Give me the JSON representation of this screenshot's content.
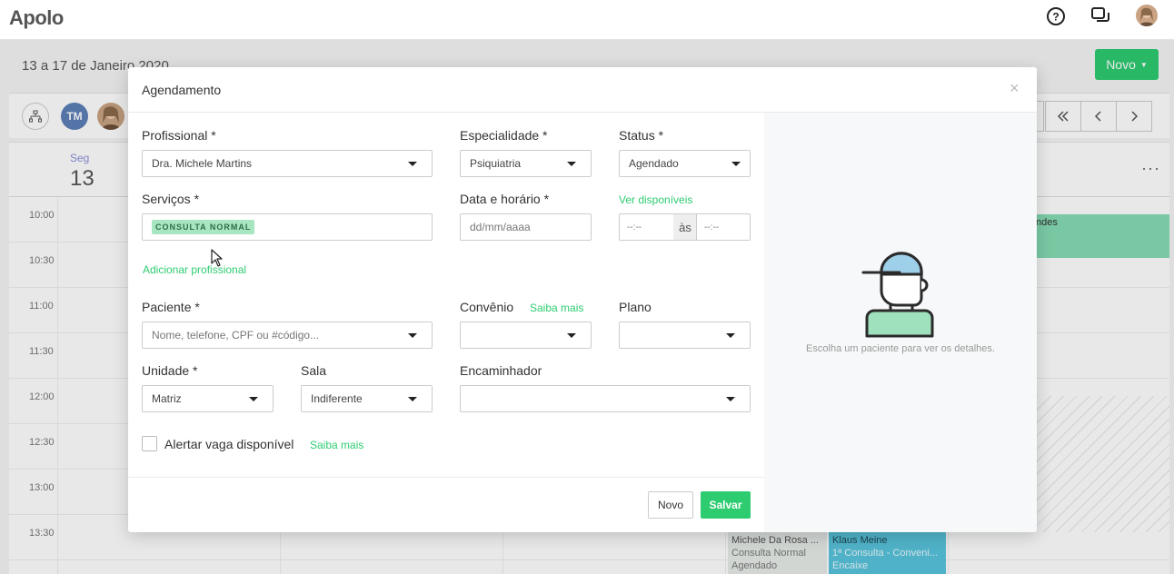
{
  "app": {
    "name": "Apolo"
  },
  "calendar": {
    "date_range": "13 a 17 de Janeiro 2020",
    "new_button": "Novo",
    "professional_initials": "TM",
    "day": {
      "weekday": "Seg",
      "number": "13"
    },
    "more": "···",
    "times": [
      "10:00",
      "10:30",
      "11:00",
      "11:30",
      "12:00",
      "12:30",
      "13:00",
      "13:30"
    ],
    "appointments": [
      {
        "name": "ndes",
        "service": "",
        "status": "",
        "color": "#86dcb4"
      },
      {
        "name": "Michele Da Rosa ...",
        "service": "Consulta Normal",
        "status": "Agendado",
        "color": "#e6ece8"
      },
      {
        "name": "Klaus Meine",
        "service": "1ª Consulta - Conveni...",
        "status": "Encaixe",
        "color": "#58c4dc"
      }
    ]
  },
  "modal": {
    "title": "Agendamento",
    "close": "×",
    "fields": {
      "profissional": {
        "label": "Profissional *",
        "value": "Dra. Michele Martins"
      },
      "especialidade": {
        "label": "Especialidade *",
        "value": "Psiquiatria"
      },
      "status": {
        "label": "Status *",
        "value": "Agendado"
      },
      "servicos": {
        "label": "Serviços *",
        "tag": "CONSULTA NORMAL"
      },
      "data_horario": {
        "label": "Data e horário *",
        "placeholder": "dd/mm/aaaa"
      },
      "ver_disponiveis": "Ver disponíveis",
      "hora_inicio": "--:--",
      "as": "às",
      "hora_fim": "--:--",
      "adicionar_profissional": "Adicionar profissional",
      "paciente": {
        "label": "Paciente *",
        "placeholder": "Nome, telefone, CPF ou #código..."
      },
      "convenio": {
        "label": "Convênio",
        "link": "Saiba mais",
        "value": ""
      },
      "plano": {
        "label": "Plano",
        "value": ""
      },
      "unidade": {
        "label": "Unidade *",
        "value": "Matriz"
      },
      "sala": {
        "label": "Sala",
        "value": "Indiferente"
      },
      "encaminhador": {
        "label": "Encaminhador",
        "value": ""
      },
      "alertar": {
        "label": "Alertar vaga disponível",
        "link": "Saiba mais",
        "checked": false
      }
    },
    "side_panel": {
      "text": "Escolha um paciente para ver os detalhes."
    },
    "buttons": {
      "novo": "Novo",
      "salvar": "Salvar"
    }
  },
  "colors": {
    "accent": "#2ecc71",
    "tag_bg": "#a8e6c1"
  }
}
